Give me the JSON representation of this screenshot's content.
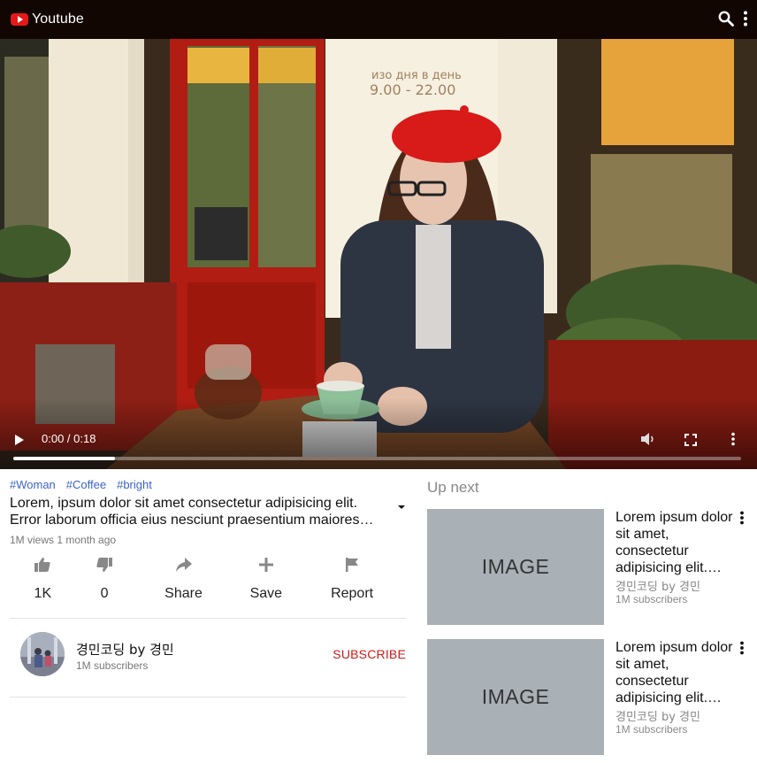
{
  "header": {
    "brand": "Youtube",
    "icons": {
      "logo": "youtube-logo-icon",
      "search": "search-icon",
      "more": "more-vertical-icon"
    },
    "colors": {
      "bar": "#120603",
      "logo": "#e41a1a"
    }
  },
  "player": {
    "time": "0:00 / 0:18",
    "progress": 0.14,
    "scene_text_line1": "изо дня в день",
    "scene_text_line2": "9.00 - 22.00",
    "icons": {
      "play": "play-icon",
      "volume": "volume-icon",
      "fullscreen": "fullscreen-icon",
      "more": "more-vertical-icon"
    }
  },
  "video": {
    "tags": [
      "#Woman",
      "#Coffee",
      "#bright"
    ],
    "title": "Lorem, ipsum dolor sit amet consectetur adipisicing elit. Error laborum officia eius nesciunt praesentium maiores…",
    "meta": "1M views 1 month ago",
    "actions": [
      {
        "icon": "thumbs-up-icon",
        "label": "1K"
      },
      {
        "icon": "thumbs-down-icon",
        "label": "0"
      },
      {
        "icon": "share-icon",
        "label": "Share"
      },
      {
        "icon": "plus-icon",
        "label": "Save"
      },
      {
        "icon": "flag-icon",
        "label": "Report"
      }
    ]
  },
  "channel": {
    "name": "경민코딩 by 경민",
    "subscribers": "1M subscribers",
    "subscribe_label": "SUBSCRIBE",
    "subscribe_color": "#cc1b1b"
  },
  "upnext": {
    "heading": "Up next",
    "items": [
      {
        "thumb_label": "IMAGE",
        "title": "Lorem ipsum dolor sit amet, consectetur adipisicing elit.…",
        "channel": "경민코딩 by 경민",
        "subscribers": "1M subscribers"
      },
      {
        "thumb_label": "IMAGE",
        "title": "Lorem ipsum dolor sit amet, consectetur adipisicing elit.…",
        "channel": "경민코딩 by 경민",
        "subscribers": "1M subscribers"
      }
    ]
  }
}
